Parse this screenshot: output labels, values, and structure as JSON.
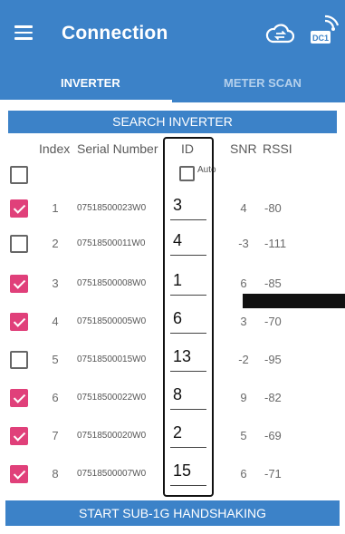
{
  "header": {
    "title": "Connection",
    "dc_badge": "DC1"
  },
  "tabs": [
    {
      "label": "INVERTER",
      "active": true
    },
    {
      "label": "METER SCAN",
      "active": false
    }
  ],
  "actions": {
    "search_label": "SEARCH INVERTER",
    "start_label": "START SUB-1G HANDSHAKING"
  },
  "table": {
    "columns": {
      "index": "Index",
      "serial": "Serial Number",
      "id": "ID",
      "snr": "SNR",
      "rssi": "RSSI"
    },
    "select_all_checked": false,
    "auto_label": "Auto",
    "auto_checked": false,
    "rows": [
      {
        "index": "1",
        "serial": "07518500023W0",
        "id": "3",
        "snr": "4",
        "rssi": "-80",
        "checked": true
      },
      {
        "index": "2",
        "serial": "07518500011W0",
        "id": "4",
        "snr": "-3",
        "rssi": "-111",
        "checked": false
      },
      {
        "index": "3",
        "serial": "07518500008W0",
        "id": "1",
        "snr": "6",
        "rssi": "-85",
        "checked": true
      },
      {
        "index": "4",
        "serial": "07518500005W0",
        "id": "6",
        "snr": "3",
        "rssi": "-70",
        "checked": true
      },
      {
        "index": "5",
        "serial": "07518500015W0",
        "id": "13",
        "snr": "-2",
        "rssi": "-95",
        "checked": false
      },
      {
        "index": "6",
        "serial": "07518500022W0",
        "id": "8",
        "snr": "9",
        "rssi": "-82",
        "checked": true
      },
      {
        "index": "7",
        "serial": "07518500020W0",
        "id": "2",
        "snr": "5",
        "rssi": "-69",
        "checked": true
      },
      {
        "index": "8",
        "serial": "07518500007W0",
        "id": "15",
        "snr": "6",
        "rssi": "-71",
        "checked": true
      }
    ]
  },
  "colors": {
    "primary": "#3c82c8",
    "check_accent": "#e0407a"
  }
}
